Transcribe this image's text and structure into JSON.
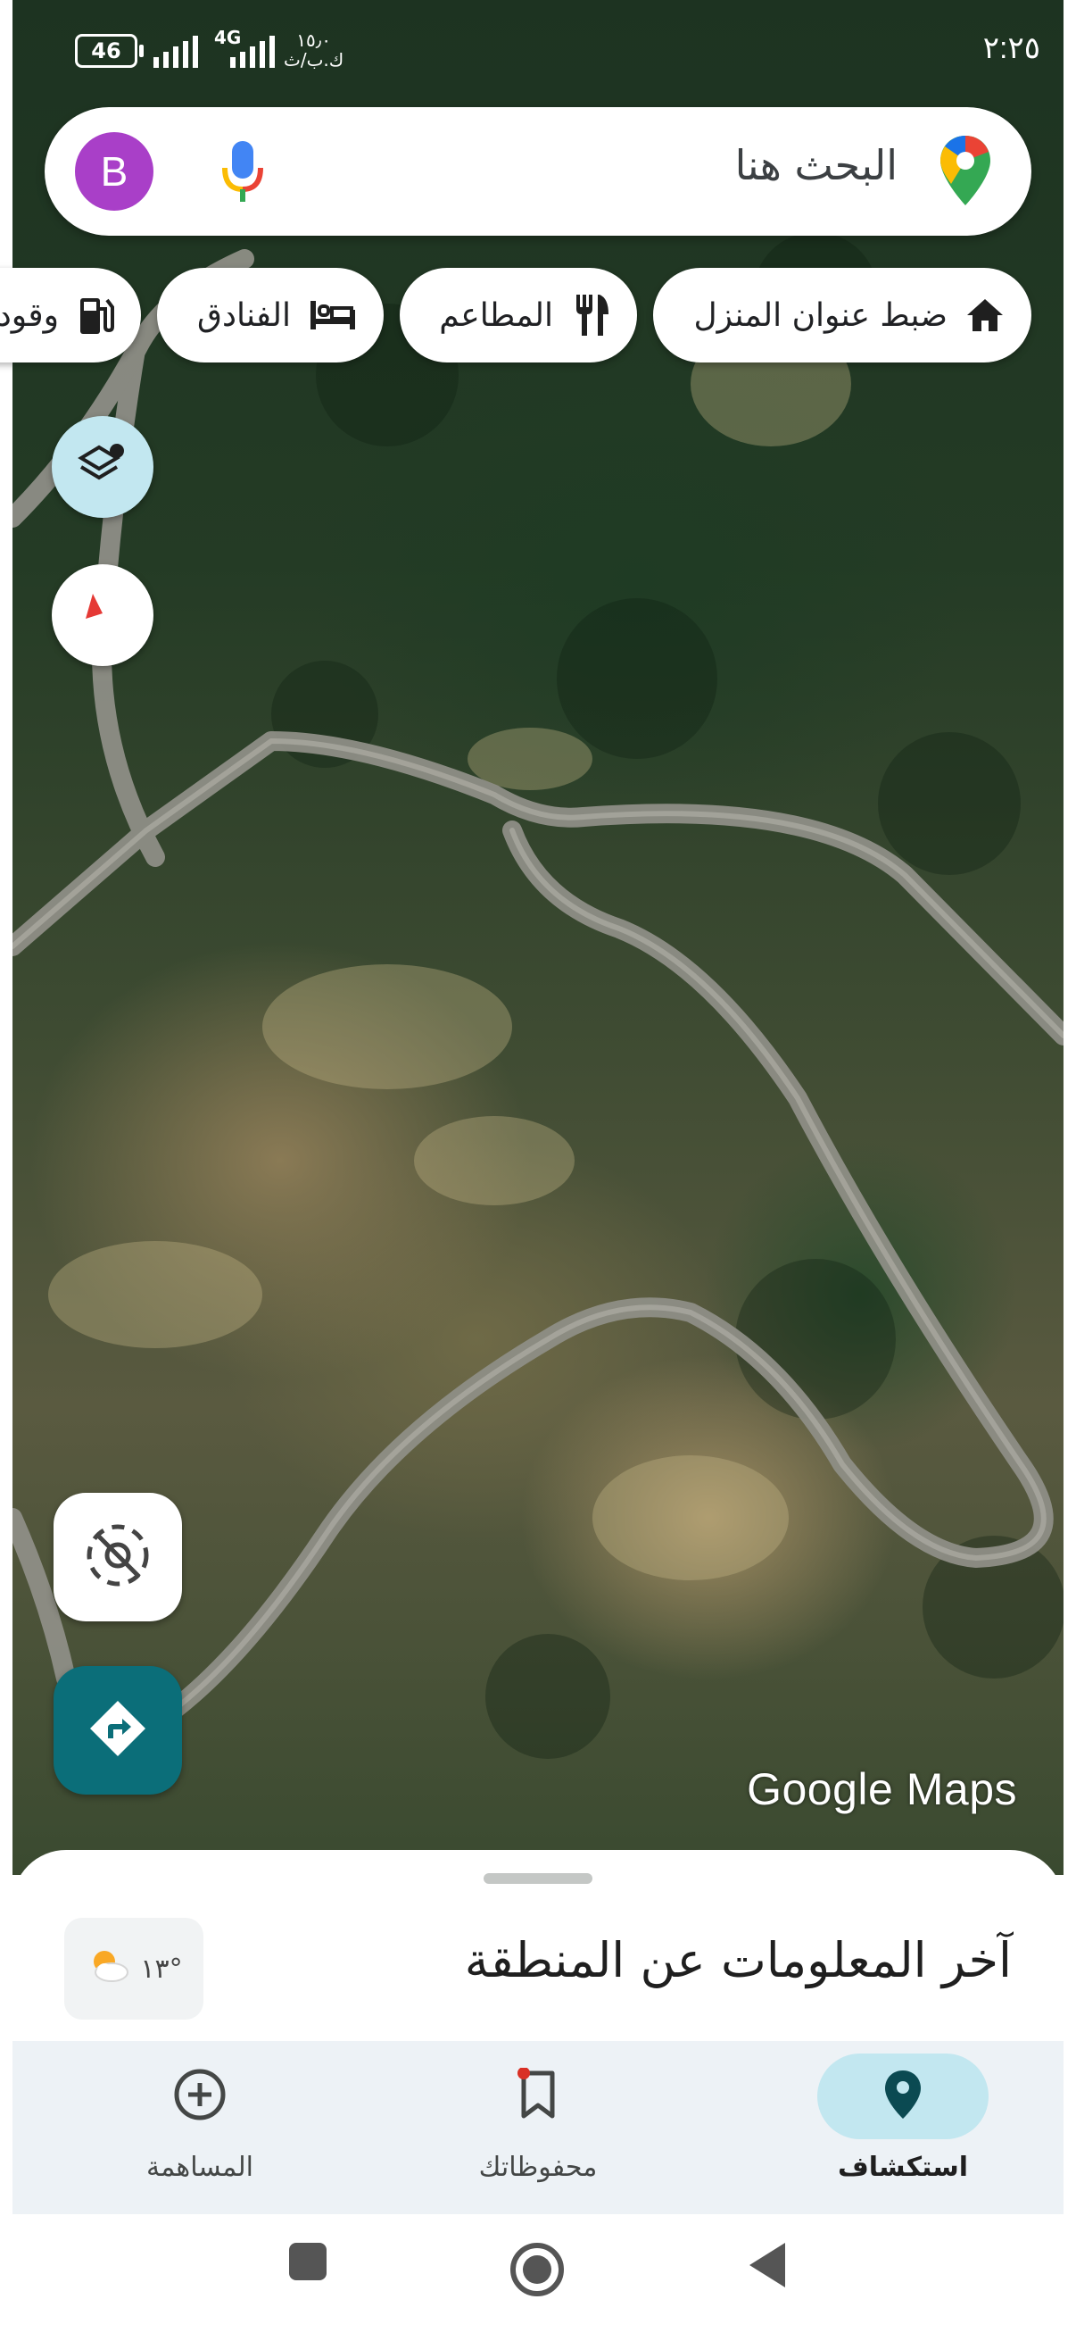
{
  "status_bar": {
    "time": "٢:٢٥",
    "battery": "46",
    "network_1": "4G",
    "network_2": "4G",
    "speed_line1": "١٥٫٠",
    "speed_line2": "ك.ب/ث"
  },
  "search": {
    "avatar_letter": "B",
    "placeholder": "البحث هنا",
    "mic_icon": "microphone-icon",
    "logo_icon": "google-maps-pin-logo"
  },
  "chips": [
    {
      "label": "ضبط عنوان المنزل",
      "icon": "home-icon"
    },
    {
      "label": "المطاعم",
      "icon": "restaurant-icon"
    },
    {
      "label": "الفنادق",
      "icon": "hotel-bed-icon"
    },
    {
      "label": "وقود",
      "icon": "gas-station-icon"
    }
  ],
  "map": {
    "watermark": "Google Maps",
    "layers_icon": "layers-icon",
    "compass_icon": "compass-icon",
    "location_icon": "location-disabled-icon",
    "directions_icon": "directions-icon"
  },
  "sheet": {
    "title": "آخر المعلومات عن المنطقة",
    "weather_temp": "١٣°",
    "weather_icon": "partly-cloudy-icon"
  },
  "nav": {
    "items": [
      {
        "label": "استكشاف",
        "icon": "explore-pin-icon",
        "active": true
      },
      {
        "label": "محفوظاتك",
        "icon": "bookmark-icon",
        "active": false
      },
      {
        "label": "المساهمة",
        "icon": "add-circle-icon",
        "active": false
      }
    ]
  },
  "colors": {
    "accent_teal": "#0b6e79",
    "active_pill": "#c2e7f0",
    "avatar": "#a93fc8",
    "nav_bg": "#edf2f6"
  }
}
